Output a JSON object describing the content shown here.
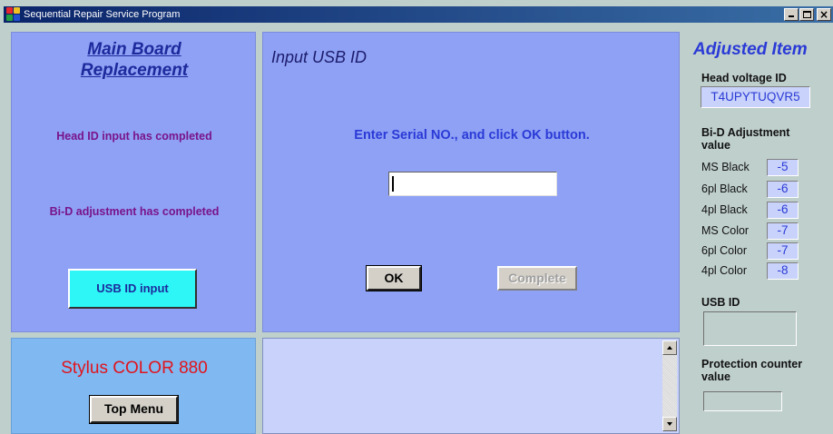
{
  "window": {
    "title": "Sequential Repair Service Program"
  },
  "left_panel": {
    "title_line1": "Main Board",
    "title_line2": "Replacement",
    "status1": "Head ID input has completed",
    "status2": "Bi-D adjustment has completed",
    "usb_button": "USB ID input"
  },
  "center_panel": {
    "title": "Input USB ID",
    "instruction": "Enter Serial NO., and click OK button.",
    "serial_value": "",
    "ok_button": "OK",
    "complete_button": "Complete"
  },
  "left_bottom": {
    "model": "Stylus COLOR 880",
    "top_menu_button": "Top Menu"
  },
  "right_panel": {
    "title": "Adjusted Item",
    "head_voltage_label": "Head voltage ID",
    "head_voltage_value": "T4UPYTUQVR5",
    "bid_label_line1": "Bi-D Adjustment",
    "bid_label_line2": "value",
    "bid_rows": [
      {
        "name": "MS Black",
        "value": "-5"
      },
      {
        "name": "6pl Black",
        "value": "-6"
      },
      {
        "name": "4pl Black",
        "value": "-6"
      },
      {
        "name": "MS Color",
        "value": "-7"
      },
      {
        "name": "6pl Color",
        "value": "-7"
      },
      {
        "name": "4pl Color",
        "value": "-8"
      }
    ],
    "usb_id_label": "USB ID",
    "usb_id_value": "",
    "protection_label_line1": "Protection counter",
    "protection_label_line2": "value",
    "protection_value": ""
  },
  "colors": {
    "panel_blue": "#8fa1f5",
    "title_blue": "#1c2a9c",
    "status_purple": "#78148a",
    "cyan_button": "#2ef6f6",
    "model_red": "#e0141c",
    "value_blue": "#2a3ad6"
  },
  "icons": {
    "app": "app-icon",
    "minimize": "minimize-icon",
    "maximize": "maximize-icon",
    "close": "close-icon"
  }
}
